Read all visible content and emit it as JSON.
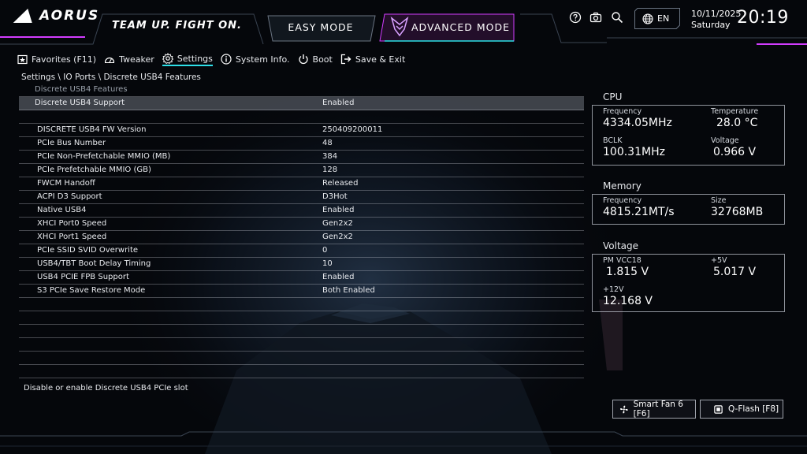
{
  "header": {
    "brand": "AORUS",
    "slogan": "TEAM UP. FIGHT ON.",
    "easy_mode_label": "EASY MODE",
    "advanced_mode_label": "ADVANCED MODE",
    "language": "EN",
    "date": "10/11/2025",
    "weekday": "Saturday",
    "time": "20:19",
    "icons": [
      "help-icon",
      "camera-icon",
      "search-icon",
      "globe-icon"
    ]
  },
  "nav": {
    "items": [
      {
        "label": "Favorites (F11)",
        "icon": "favorites-icon"
      },
      {
        "label": "Tweaker",
        "icon": "speedometer-icon"
      },
      {
        "label": "Settings",
        "icon": "gear-icon",
        "active": true
      },
      {
        "label": "System Info.",
        "icon": "info-icon"
      },
      {
        "label": "Boot",
        "icon": "power-icon"
      },
      {
        "label": "Save & Exit",
        "icon": "exit-icon"
      }
    ]
  },
  "breadcrumb": "Settings \\ IO Ports \\ Discrete USB4 Features",
  "settings": {
    "section_title": "Discrete USB4 Features",
    "selected": {
      "label": "Discrete USB4 Support",
      "value": "Enabled"
    },
    "items": [
      {
        "label": "DISCRETE USB4 FW Version",
        "value": "250409200011"
      },
      {
        "label": "PCIe Bus Number",
        "value": "48"
      },
      {
        "label": "PCIe Non-Prefetchable MMIO (MB)",
        "value": "384"
      },
      {
        "label": "PCIe Prefetchable MMIO (GB)",
        "value": "128"
      },
      {
        "label": "FWCM Handoff",
        "value": "Released"
      },
      {
        "label": "ACPI D3 Support",
        "value": "D3Hot"
      },
      {
        "label": "Native USB4",
        "value": "Enabled"
      },
      {
        "label": "XHCI Port0 Speed",
        "value": "Gen2x2"
      },
      {
        "label": "XHCI Port1 Speed",
        "value": "Gen2x2"
      },
      {
        "label": "PCIe SSID SVID Overwrite",
        "value": "0"
      },
      {
        "label": "USB4/TBT Boot Delay Timing",
        "value": "10"
      },
      {
        "label": "USB4 PCIE FPB Support",
        "value": "Enabled"
      },
      {
        "label": "S3 PCIe Save Restore Mode",
        "value": "Both Enabled"
      }
    ],
    "empty_rows": 6
  },
  "help_text": "Disable or enable Discrete USB4 PCIe slot",
  "cpu": {
    "title": "CPU",
    "frequency_label": "Frequency",
    "frequency": "4334.05MHz",
    "temperature_label": "Temperature",
    "temperature": "28.0 °C",
    "bclk_label": "BCLK",
    "bclk": "100.31MHz",
    "voltage_label": "Voltage",
    "voltage": "0.966 V"
  },
  "memory": {
    "title": "Memory",
    "frequency_label": "Frequency",
    "frequency": "4815.21MT/s",
    "size_label": "Size",
    "size": "32768MB"
  },
  "voltage": {
    "title": "Voltage",
    "pm_vcc18_label": "PM VCC18",
    "pm_vcc18": "1.815 V",
    "v5_label": "+5V",
    "v5": "5.017 V",
    "v12_label": "+12V",
    "v12": "12.168 V"
  },
  "footer": {
    "smart_fan_label": "Smart Fan 6 [F6]",
    "qflash_label": "Q-Flash [F8]"
  },
  "colors": {
    "accent_cyan": "#2ee0e8",
    "accent_magenta": "#d23cff",
    "background": "#05070b"
  }
}
